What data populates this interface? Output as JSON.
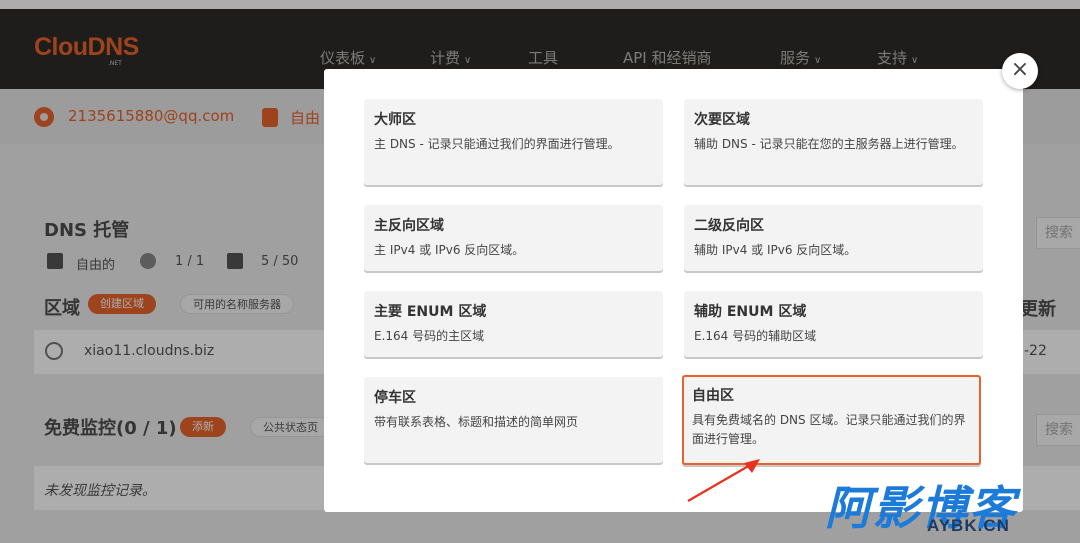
{
  "header": {
    "logo": "ClouDNS",
    "logo_sub": ".NET",
    "nav": [
      {
        "label": "仪表板",
        "has_chevron": true
      },
      {
        "label": "计费",
        "has_chevron": true
      },
      {
        "label": "工具",
        "has_chevron": false
      },
      {
        "label": "API 和经销商",
        "has_chevron": false
      },
      {
        "label": "服务",
        "has_chevron": true
      },
      {
        "label": "支持",
        "has_chevron": true
      }
    ],
    "chevron": "∨"
  },
  "account": {
    "email": "2135615880@qq.com",
    "plan": "自由"
  },
  "dns_hosting": {
    "title": "DNS 托管",
    "plan": "自由的",
    "servers": "1 / 1",
    "records": "5 / 50",
    "zones_title": "区域",
    "create_zone": "创建区域",
    "available_ns": "可用的名称服务器",
    "zone_row": "xiao11.cloudns.biz",
    "search_placeholder": "搜索",
    "updated_label": "更新",
    "date_fragment": "-22"
  },
  "monitoring": {
    "title": "免费监控(0 / 1)",
    "add_button": "添新",
    "public_status": "公共状态页",
    "search_placeholder": "搜索",
    "empty_note": "未发现监控记录。"
  },
  "modal": {
    "close_glyph": "×",
    "cards": [
      {
        "title": "大师区",
        "desc": "主 DNS - 记录只能通过我们的界面进行管理。"
      },
      {
        "title": "次要区域",
        "desc": "辅助 DNS - 记录只能在您的主服务器上进行管理。"
      },
      {
        "title": "主反向区域",
        "desc": "主 IPv4 或 IPv6 反向区域。"
      },
      {
        "title": "二级反向区",
        "desc": "辅助 IPv4 或 IPv6 反向区域。"
      },
      {
        "title": "主要 ENUM 区域",
        "desc": "E.164 号码的主区域"
      },
      {
        "title": "辅助 ENUM 区域",
        "desc": "E.164 号码的辅助区域"
      },
      {
        "title": "停车区",
        "desc": "带有联系表格、标题和描述的简单网页"
      },
      {
        "title": "自由区",
        "desc": "具有免费域名的 DNS 区域。记录只能通过我们的界面进行管理。"
      }
    ],
    "highlighted_index": 7
  },
  "watermark": {
    "text": "阿影博客",
    "sub": "AYBK.CN"
  },
  "colors": {
    "accent": "#e8632b",
    "header_bg": "#2e2b28",
    "watermark_blue": "#1c7bd9"
  }
}
